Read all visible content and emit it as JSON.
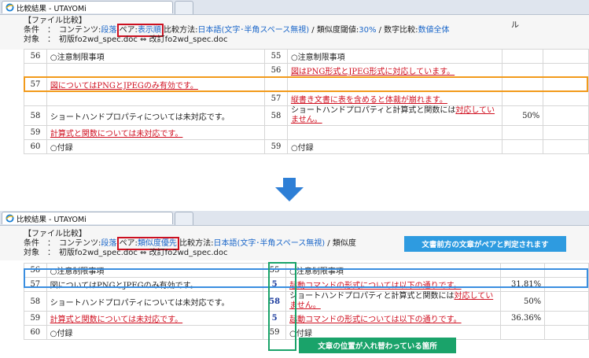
{
  "window_title": "比較結果 - UTAYOMi",
  "top": {
    "heading": "【ファイル比較】",
    "cond_label": "条件　：　コンテンツ:",
    "content_value": "段落",
    "pair_label": "ペア:",
    "pair_value": "表示順",
    "method_label": "比較方法:",
    "method_value": "日本語(文字･半角スペース無視)",
    "sep1": " / 類似度閾値:",
    "threshold": "30%",
    "sep2": " / 数字比較:",
    "number_compare": "数値全体",
    "target": "対象　：　初版fo2wd_spec.doc ⇔ 改訂fo2wd_spec.doc",
    "side_text": "ル",
    "rows": [
      {
        "ln": "56",
        "l": "○注意制限事項",
        "rn": "55",
        "r": "○注意制限事項",
        "p": ""
      },
      {
        "ln": "",
        "l": "",
        "rn": "56",
        "r": "図はPNG形式とJPEG形式に対応しています。",
        "p": ""
      },
      {
        "ln": "57",
        "l": "図についてはPNGとJPEGのみ有効です。",
        "rn": "",
        "r": "",
        "p": ""
      },
      {
        "ln": "",
        "l": "",
        "rn": "57",
        "r": "縦書き文書に表を含めると体裁が崩れます。",
        "p": ""
      },
      {
        "ln": "58",
        "l": "ショートハンドプロパティについては未対応です。",
        "rn": "58",
        "r1": "ショートハンドプロパティと計算式と関数には",
        "r2": "対応していません。",
        "p": "50%"
      },
      {
        "ln": "59",
        "l": "計算式と関数については未対応です。",
        "rn": "",
        "r": "",
        "p": ""
      },
      {
        "ln": "60",
        "l": "○付録",
        "rn": "59",
        "r": "○付録",
        "p": ""
      }
    ]
  },
  "bottom": {
    "heading": "【ファイル比較】",
    "cond_label": "条件　：　コンテンツ:",
    "content_value": "段落",
    "pair_label": "ペア:",
    "pair_value": "類似度優先",
    "method_label": "比較方法:",
    "method_value": "日本語(文字･半角スペース無視)",
    "sep1": " / 類似度",
    "target": "対象　：　初版fo2wd_spec.doc ⇔ 改訂fo2wd_spec.doc",
    "rows": [
      {
        "ln": "56",
        "l": "○注意制限事項",
        "rn": "55",
        "r": "○注意制限事項",
        "p": ""
      },
      {
        "ln": "57",
        "l": "図についてはPNGとJPEGのみ有効です。",
        "rn": "5",
        "r": "起動コマンドの形式については以下の通りです。",
        "p": "31.81%"
      },
      {
        "ln": "58",
        "l": "ショートハンドプロパティについては未対応です。",
        "rn": "58",
        "r1": "ショートハンドプロパティと計算式と関数には",
        "r2": "対応していません。",
        "p": "50%"
      },
      {
        "ln": "59",
        "l": "計算式と関数については未対応です。",
        "rn": "5",
        "r": "起動コマンドの形式については以下の通りです。",
        "p": "36.36%"
      },
      {
        "ln": "60",
        "l": "○付録",
        "rn": "59",
        "r": "○付録",
        "p": ""
      }
    ]
  },
  "callout_blue": "文書前方の文章がペアと判定されます",
  "callout_green": "文章の位置が入れ替わっている箇所",
  "colors": {
    "orange": "#f29a1b",
    "blue": "#3a8ee0",
    "green": "#1aa36a",
    "red": "#d01020",
    "link": "#1a66c9"
  }
}
